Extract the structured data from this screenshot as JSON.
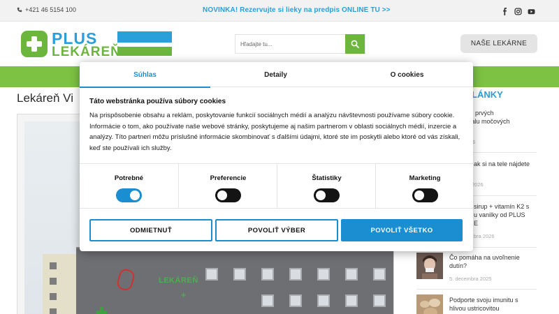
{
  "topbar": {
    "phone": "+421 46 5154 100",
    "promo": "NOVINKA! Rezervujte si lieky na predpis ONLINE TU >>",
    "social": [
      "facebook-icon",
      "instagram-icon",
      "youtube-icon"
    ]
  },
  "header": {
    "logo_line1": "PLUS",
    "logo_line2": "LEKÁREŇ",
    "search_placeholder": "Hľadajte tu...",
    "pharmacies_label": "NAŠE LEKÁRNE"
  },
  "page": {
    "title": "Lekáreň Vi",
    "photo_sign": "LEKÁREŇ",
    "photo_sign_cross": "+",
    "photo_green_cross": "✚"
  },
  "sidebar": {
    "heading": "LÁNKY",
    "items": [
      {
        "title_lines": [
          "omoc pri prvých",
          "och zápalu močových"
        ],
        "date": "26"
      },
      {
        "title_lines": [
          "ak si na tele nájdete"
        ],
        "date": "2026"
      },
      {
        "title_lines": [
          "sirup + vitamín K2 s",
          "u vanilky od PLUS",
          "E"
        ],
        "date": "bra 2026"
      },
      {
        "title_lines": [
          "Čo pomáha na uvoľnenie",
          "dutín?"
        ],
        "date": "5. decembra 2025"
      },
      {
        "title_lines": [
          "Podporte svoju imunitu s",
          "hlivou ustricovitou"
        ],
        "date": ""
      }
    ]
  },
  "cookie": {
    "tabs": [
      "Súhlas",
      "Detaily",
      "O cookies"
    ],
    "active_tab": "Súhlas",
    "title": "Táto webstránka používa súbory cookies",
    "body": "Na prispôsobenie obsahu a reklám, poskytovanie funkcií sociálnych médií a analýzu návštevnosti používame súbory cookie. Informácie o tom, ako používate naše webové stránky, poskytujeme aj našim partnerom v oblasti sociálnych médií, inzercie a analýzy. Títo partneri môžu príslušné informácie skombinovať s ďalšími údajmi, ktoré ste im poskytli alebo ktoré od vás získali, keď ste používali ich služby.",
    "categories": [
      {
        "label": "Potrebné",
        "enabled": true
      },
      {
        "label": "Preferencie",
        "enabled": false
      },
      {
        "label": "Štatistiky",
        "enabled": false
      },
      {
        "label": "Marketing",
        "enabled": false
      }
    ],
    "buttons": {
      "reject": "ODMIETNUŤ",
      "allow_selection": "POVOLIŤ VÝBER",
      "allow_all": "POVOLIŤ VŠETKO"
    }
  },
  "colors": {
    "brand_blue": "#2b9fd9",
    "brand_green": "#6cb63d",
    "accent": "#1b8ed1"
  }
}
